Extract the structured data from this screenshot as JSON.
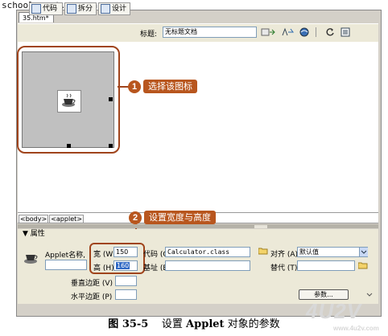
{
  "watermark_top": "school.enet.com.cn",
  "document_tab": "35.htm*",
  "toolbar": {
    "code_label": "代码",
    "split_label": "拆分",
    "design_label": "设计",
    "title_label": "标题:",
    "title_value": "无标题文档"
  },
  "callouts": [
    {
      "number": "1",
      "text": "选择该图标"
    },
    {
      "number": "2",
      "text": "设置宽度与高度"
    }
  ],
  "tag_selector": [
    "<body>",
    "<applet>"
  ],
  "properties": {
    "header": "▼ 属性",
    "object_label": "Applet名称,",
    "width_label": "宽 (W)",
    "width_value": "150",
    "height_label": "高 (H)",
    "height_value": "160",
    "code_label": "代码 (C)",
    "code_value": "Calculator.class",
    "base_label": "基址 (B)",
    "base_value": "",
    "align_label": "对齐 (A)",
    "align_value": "默认值",
    "alt_label": "替代 (T)",
    "alt_value": "",
    "vspace_label": "垂直边距 (V)",
    "hspace_label": "水平边距 (P)",
    "params_button": "参数..."
  },
  "caption": {
    "figure_number": "图 35-5",
    "text_before": "设置",
    "applet_word": "Applet",
    "text_after": "对象的参数"
  },
  "watermark_logo": {
    "main": "4U2V",
    "sub": "www.4u2v.com"
  }
}
